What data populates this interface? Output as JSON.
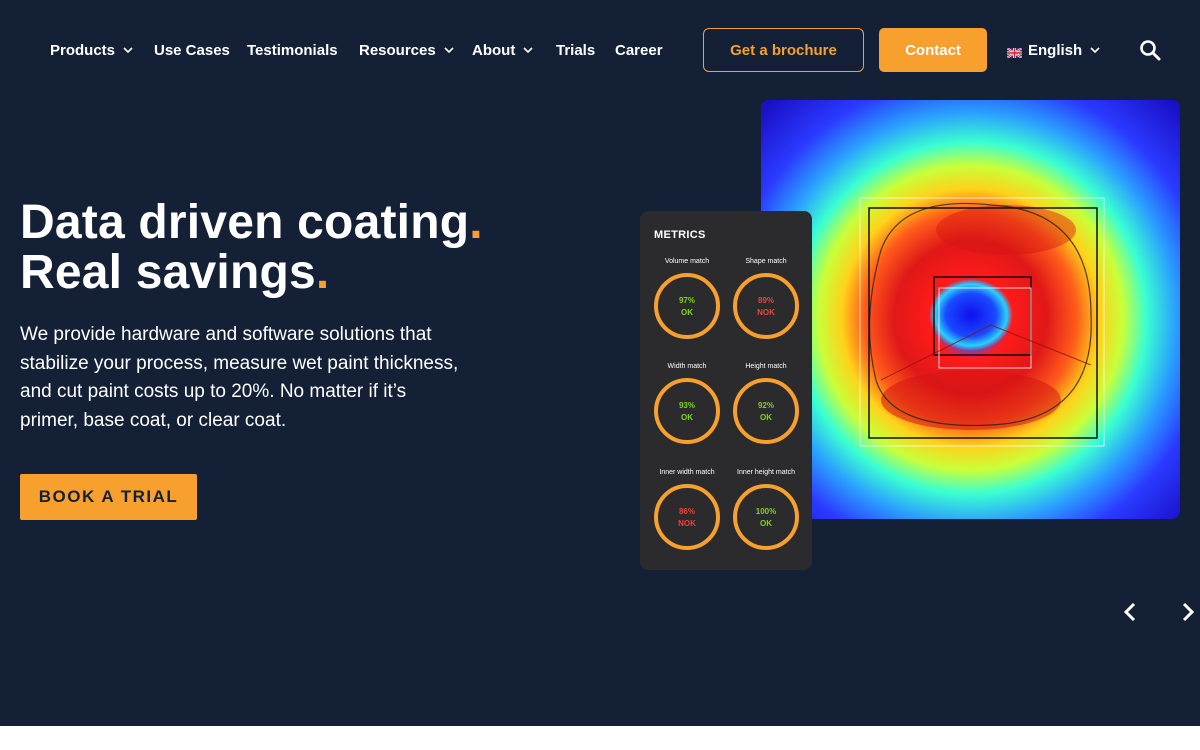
{
  "nav": {
    "items": [
      {
        "label": "Products",
        "dropdown": true
      },
      {
        "label": "Use Cases",
        "dropdown": false
      },
      {
        "label": "Testimonials",
        "dropdown": false
      },
      {
        "label": "Resources",
        "dropdown": true
      },
      {
        "label": "About",
        "dropdown": true
      },
      {
        "label": "Trials",
        "dropdown": false
      },
      {
        "label": "Career",
        "dropdown": false
      }
    ],
    "brochure_label": "Get a brochure",
    "contact_label": "Contact",
    "language_label": "English",
    "search_icon": "search-icon"
  },
  "hero": {
    "headline_line1": "Data driven coating",
    "headline_line2": "Real savings",
    "headline_dot": ".",
    "description": "We provide hardware and software solutions that stabilize your process, measure wet paint thickness, and cut paint costs up to 20%. No matter if it’s primer, base coat, or clear coat.",
    "cta_label": "BOOK A TRIAL"
  },
  "metrics": {
    "title": "METRICS",
    "gauges": [
      {
        "label": "Volume match",
        "value": "97%",
        "status": "OK"
      },
      {
        "label": "Shape match",
        "value": "89%",
        "status": "NOK"
      },
      {
        "label": "Width match",
        "value": "93%",
        "status": "OK"
      },
      {
        "label": "Height match",
        "value": "92%",
        "status": "OK"
      },
      {
        "label": "Inner width match",
        "value": "86%",
        "status": "NOK"
      },
      {
        "label": "Inner height match",
        "value": "100%",
        "status": "OK"
      }
    ]
  },
  "colors": {
    "background": "#132035",
    "accent": "#f7a02d",
    "ok": "#7ed321",
    "nok": "#e8443a",
    "card": "#2b2b2d"
  },
  "carousel": {
    "prev_icon": "chevron-left-icon",
    "next_icon": "chevron-right-icon"
  }
}
